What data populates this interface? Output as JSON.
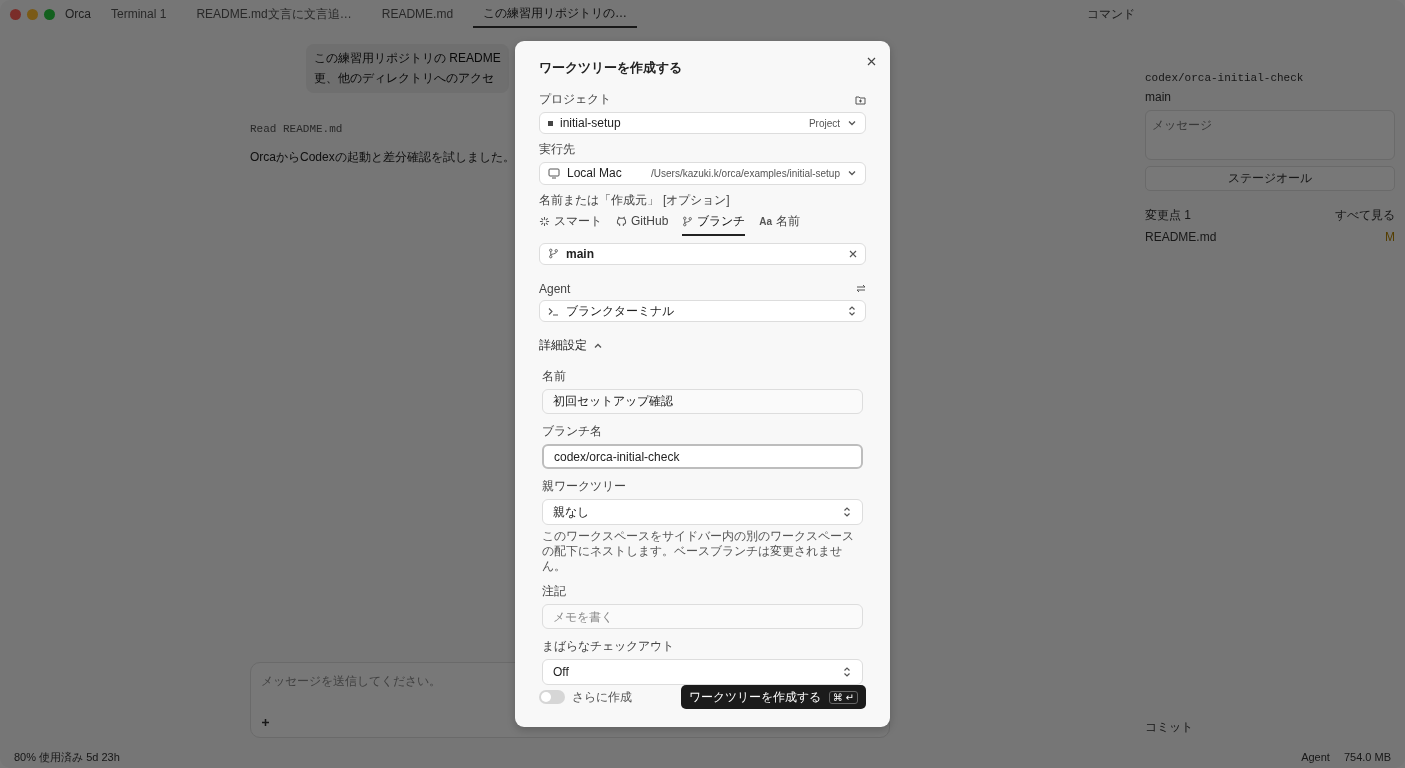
{
  "app": {
    "name": "Orca",
    "tabs": [
      {
        "label": "Terminal 1",
        "selected": false
      },
      {
        "label": "README.md文言に文言追…",
        "selected": false
      },
      {
        "label": "README.md",
        "selected": false
      },
      {
        "label": "この練習用リポジトリの…",
        "selected": true
      }
    ],
    "command": "コマンド"
  },
  "chat": {
    "bubble_lines": [
      "この練習用リポジトリの README",
      "更、他のディレクトリへのアクセ"
    ],
    "tool_line": "Read README.md",
    "reply": "OrcaからCodexの起動と差分確認を試しました。",
    "composer_placeholder": "メッセージを送信してください。"
  },
  "source_control": {
    "branch": "codex/orca-initial-check",
    "base": "main",
    "message_placeholder": "メッセージ",
    "stage_all": "ステージオール",
    "changes_label": "変更点 1",
    "view_all": "すべて見る",
    "files": [
      {
        "name": "README.md",
        "status": "M"
      }
    ],
    "commits_label": "コミット"
  },
  "status_bar": {
    "usage": "80% 使用済み 5d 23h",
    "agent": "Agent",
    "memory": "754.0 MB"
  },
  "dialog": {
    "title": "ワークツリーを作成する",
    "project": {
      "label": "プロジェクト",
      "value": "initial-setup",
      "tag": "Project"
    },
    "target": {
      "label": "実行先",
      "value": "Local Mac",
      "path": "/Users/kazuki.k/orca/examples/initial-setup"
    },
    "source": {
      "label": "名前または「作成元」",
      "hint": "[オプション]",
      "tabs": [
        {
          "label": "スマート",
          "kind": "smart",
          "selected": false
        },
        {
          "label": "GitHub",
          "kind": "github",
          "selected": false
        },
        {
          "label": "ブランチ",
          "kind": "branch",
          "selected": true
        },
        {
          "label": "名前",
          "kind": "name",
          "glyph": "Aa",
          "selected": false
        }
      ],
      "value": "main"
    },
    "agent": {
      "label": "Agent",
      "value": "ブランクターミナル"
    },
    "advanced": {
      "label": "詳細設定",
      "expanded": true,
      "fields": [
        {
          "kind": "input",
          "label": "名前",
          "value": "初回セットアップ確認",
          "focused": false
        },
        {
          "kind": "input",
          "label": "ブランチ名",
          "value": "codex/orca-initial-check",
          "focused": true
        },
        {
          "kind": "select",
          "label": "親ワークツリー",
          "value": "親なし",
          "help": "このワークスペースをサイドバー内の別のワークスペースの配下にネストします。ベースブランチは変更されません。"
        },
        {
          "kind": "input",
          "label": "注記",
          "placeholder": "メモを書く",
          "focused": false
        },
        {
          "kind": "select",
          "label": "まばらなチェックアウト",
          "value": "Off"
        }
      ]
    },
    "create_more": {
      "label": "さらに作成",
      "on": false
    },
    "submit": {
      "label": "ワークツリーを作成する",
      "shortcut": "⌘ ↵"
    }
  }
}
